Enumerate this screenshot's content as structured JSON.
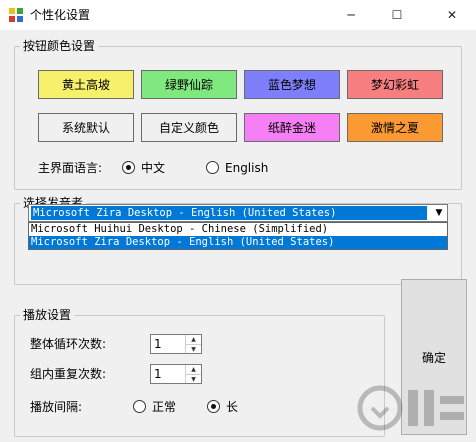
{
  "window": {
    "title": "个性化设置",
    "controls": {
      "minimize": "─",
      "maximize": "☐",
      "close": "✕"
    }
  },
  "button_color_group": {
    "title": "按钮颜色设置",
    "buttons": [
      {
        "label": "黄土高坡",
        "color": "#f7f06a"
      },
      {
        "label": "绿野仙踪",
        "color": "#7fe87f"
      },
      {
        "label": "蓝色梦想",
        "color": "#7f7ffb"
      },
      {
        "label": "梦幻彩虹",
        "color": "#f77f7f"
      },
      {
        "label": "系统默认",
        "color": "#f0f0f0"
      },
      {
        "label": "自定义颜色",
        "color": "#f0f0f0"
      },
      {
        "label": "纸醉金迷",
        "color": "#f580f5"
      },
      {
        "label": "激情之夏",
        "color": "#fb9933"
      }
    ],
    "language_label": "主界面语言:",
    "language_options": [
      {
        "label": "中文",
        "checked": true
      },
      {
        "label": "English",
        "checked": false
      }
    ]
  },
  "voice_group": {
    "title": "选择发音者",
    "selected": "Microsoft Zira Desktop - English (United States)",
    "options": [
      "Microsoft Huihui Desktop - Chinese (Simplified)",
      "Microsoft Zira Desktop - English (United States)"
    ],
    "highlighted_index": 1
  },
  "playback_group": {
    "title": "播放设置",
    "loop_label": "整体循环次数:",
    "loop_value": "1",
    "repeat_label": "组内重复次数:",
    "repeat_value": "1",
    "interval_label": "播放间隔:",
    "interval_options": [
      {
        "label": "正常",
        "checked": false
      },
      {
        "label": "长",
        "checked": true
      }
    ]
  },
  "ok_button": {
    "label": "确定"
  },
  "colors": {
    "selection": "#0078d7",
    "client_bg": "#f0f0f0",
    "group_border": "#c8c8c8"
  },
  "icons": {
    "app": "palette-icon",
    "dropdown": "chevron-down-icon",
    "watermark": "download-logo"
  }
}
